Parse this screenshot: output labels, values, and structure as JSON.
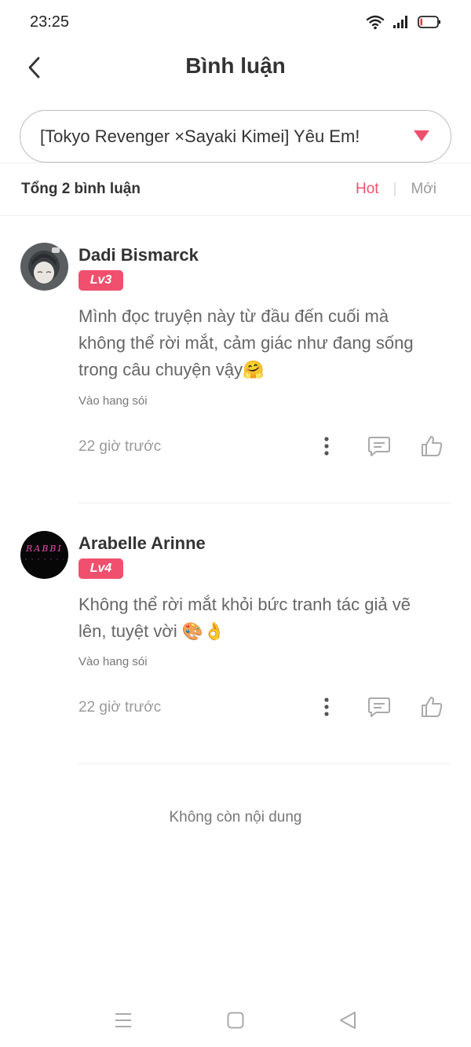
{
  "status_bar": {
    "time": "23:25",
    "icons": [
      "wifi-icon",
      "signal-icon",
      "battery-icon"
    ]
  },
  "header": {
    "title": "Bình luận",
    "back_icon": "chevron-left-icon"
  },
  "chapter_selector": {
    "value": "[Tokyo Revenger ×Sayaki Kimei] Yêu Em!",
    "caret_icon": "triangle-down-icon"
  },
  "summary": {
    "count_label": "Tổng 2 bình luận",
    "sort_tabs": [
      {
        "label": "Hot",
        "active": true
      },
      {
        "label": "Mới",
        "active": false
      }
    ]
  },
  "comments": [
    {
      "username": "Dadi Bismarck",
      "level": "Lv3",
      "text": "Mình đọc truyện này từ đầu đến cuối mà không thể rời mắt, cảm giác như đang sống trong câu chuyện vậy🤗",
      "source": "Vào hang sói",
      "time": "22 giờ trước"
    },
    {
      "username": "Arabelle Arinne",
      "level": "Lv4",
      "text": "Không thể rời mắt khỏi bức tranh tác giả vẽ lên, tuyệt vời 🎨👌",
      "source": "Vào hang sói",
      "time": "22 giờ trước",
      "avatar_text": "RABBI"
    }
  ],
  "end_message": "Không còn nội dung",
  "colors": {
    "accent": "#f0506e",
    "text": "#333333",
    "muted": "#999999"
  },
  "nav_bar": {
    "icons": [
      "menu-icon",
      "home-square-icon",
      "back-triangle-icon"
    ]
  }
}
